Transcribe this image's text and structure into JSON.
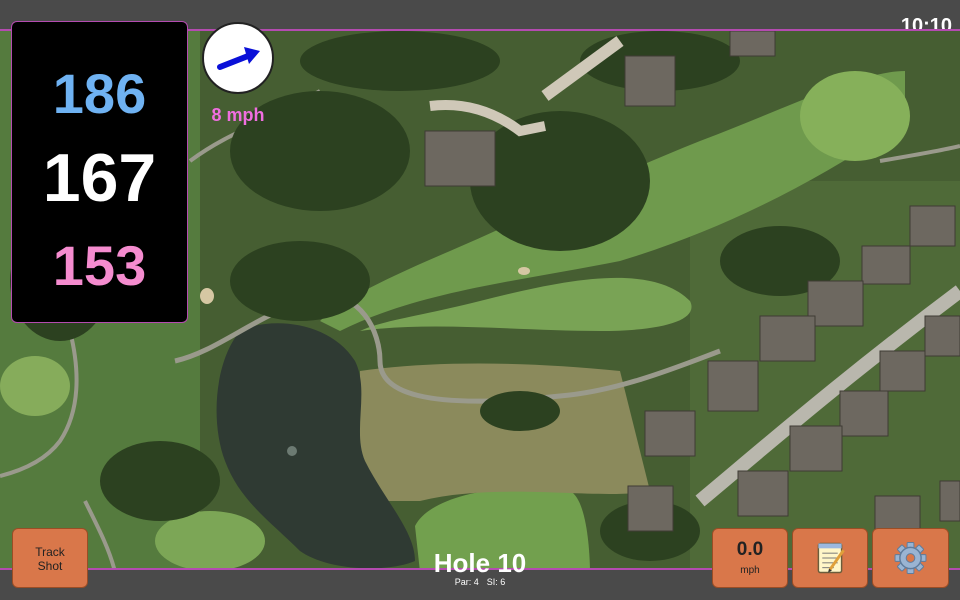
{
  "status": {
    "time": "10:10"
  },
  "distances": {
    "back": "186",
    "middle": "167",
    "front": "153"
  },
  "wind": {
    "speed": "8 mph",
    "direction_icon": "arrow-icon"
  },
  "hole": {
    "title": "Hole 10",
    "par": "Par: 4",
    "si": "SI: 6"
  },
  "buttons": {
    "track_shot": "Track\nShot",
    "speed_value": "0.0",
    "speed_unit": "mph",
    "notes_icon": "notepad-icon",
    "settings_icon": "gear-icon"
  },
  "colors": {
    "back": "#6fb2f2",
    "middle": "#ffffff",
    "front": "#f58ccf",
    "wind_text": "#f06ee0",
    "wind_arrow": "#0a10d8",
    "frame": "#b44bb0",
    "button": "#d9774a"
  }
}
